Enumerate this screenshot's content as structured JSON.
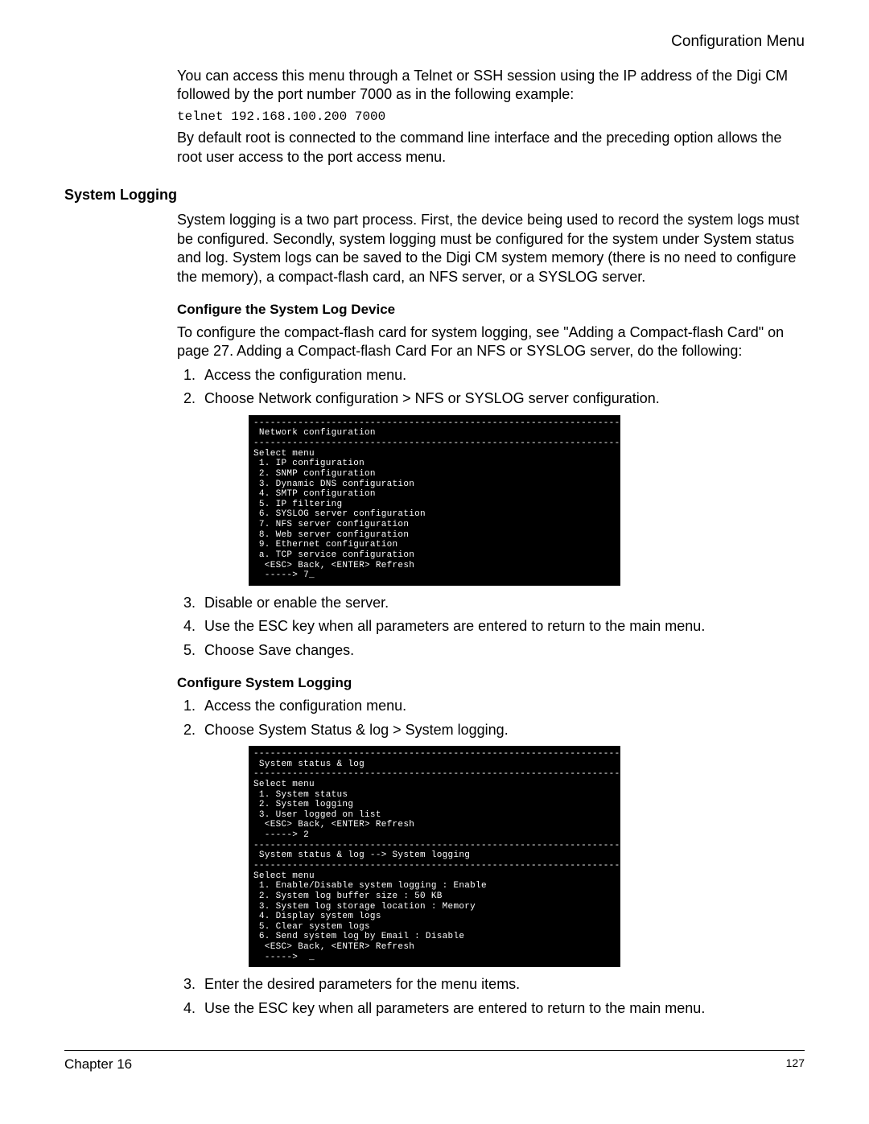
{
  "header": {
    "title": "Configuration Menu"
  },
  "intro": {
    "p1": "You can access this menu through a Telnet or SSH session using the IP address of the Digi CM followed by the port number 7000 as in the following example:",
    "code": "telnet 192.168.100.200 7000",
    "p2": "By default root is connected to the command line interface and the preceding option allows the root user access to the port access menu."
  },
  "section": {
    "title": "System Logging",
    "p1": "System logging is a two part process. First, the device being used to record the system logs must be configured. Secondly, system logging must be configured for the system under System status and log. System logs can be saved to the Digi CM system memory (there is no need to configure the memory), a compact-flash card, an NFS server, or a SYSLOG server.",
    "sub1": {
      "title": "Configure the System Log Device",
      "p": "To configure the compact-flash card for system logging, see \"Adding a Compact-flash Card\" on page 27. Adding a Compact-flash Card For an NFS or SYSLOG server, do the following:",
      "steps_a": [
        "Access the configuration menu.",
        "Choose Network configuration > NFS or SYSLOG server configuration."
      ],
      "terminal": "------------------------------------------------------------------------\n Network configuration\n------------------------------------------------------------------------\nSelect menu\n 1. IP configuration\n 2. SNMP configuration\n 3. Dynamic DNS configuration\n 4. SMTP configuration\n 5. IP filtering\n 6. SYSLOG server configuration\n 7. NFS server configuration\n 8. Web server configuration\n 9. Ethernet configuration\n a. TCP service configuration\n  <ESC> Back, <ENTER> Refresh\n  -----> 7_",
      "steps_b": [
        "Disable or enable the server.",
        "Use the ESC key when all parameters are entered to return to the main menu.",
        "Choose Save changes."
      ]
    },
    "sub2": {
      "title": "Configure System Logging",
      "steps_a": [
        "Access the configuration menu.",
        "Choose System Status & log > System logging."
      ],
      "terminal": "------------------------------------------------------------------------\n System status & log\n------------------------------------------------------------------------\nSelect menu\n 1. System status\n 2. System logging\n 3. User logged on list\n  <ESC> Back, <ENTER> Refresh\n  -----> 2\n------------------------------------------------------------------------\n System status & log --> System logging\n------------------------------------------------------------------------\nSelect menu\n 1. Enable/Disable system logging : Enable\n 2. System log buffer size : 50 KB\n 3. System log storage location : Memory\n 4. Display system logs\n 5. Clear system logs\n 6. Send system log by Email : Disable\n  <ESC> Back, <ENTER> Refresh\n  ----->  _",
      "steps_b": [
        "Enter the desired parameters for the menu items.",
        "Use the ESC key when all parameters are entered to return to the main menu."
      ]
    }
  },
  "footer": {
    "chapter": "Chapter 16",
    "page": "127"
  }
}
